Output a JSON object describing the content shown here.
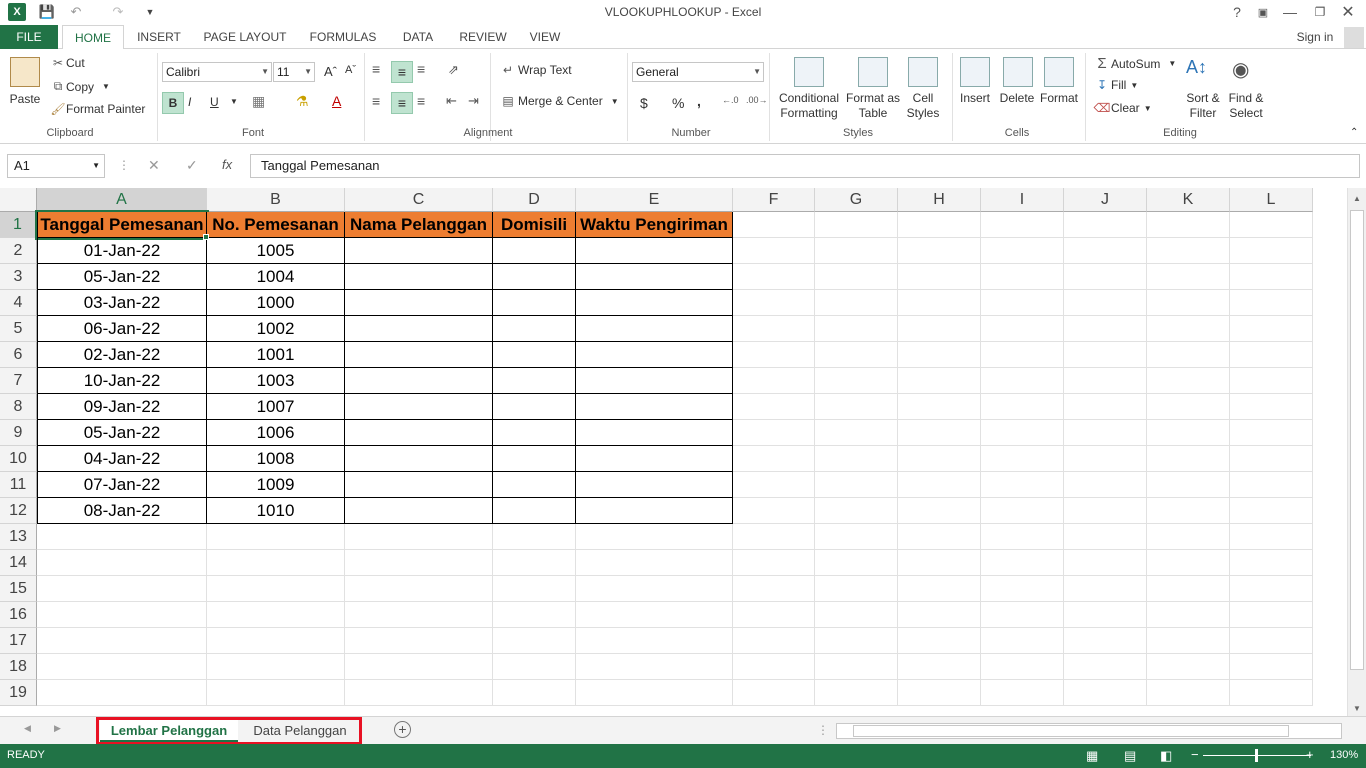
{
  "window": {
    "title": "VLOOKUPHLOOKUP - Excel",
    "help": "?",
    "signin": "Sign in"
  },
  "tabs": [
    "FILE",
    "HOME",
    "INSERT",
    "PAGE LAYOUT",
    "FORMULAS",
    "DATA",
    "REVIEW",
    "VIEW"
  ],
  "ribbon": {
    "clipboard": {
      "paste": "Paste",
      "cut": "Cut",
      "copy": "Copy",
      "format_painter": "Format Painter",
      "label": "Clipboard"
    },
    "font": {
      "name": "Calibri",
      "size": "11",
      "bold": "B",
      "italic": "I",
      "underline": "U",
      "label": "Font"
    },
    "alignment": {
      "wrap": "Wrap Text",
      "merge": "Merge & Center",
      "label": "Alignment"
    },
    "number": {
      "format": "General",
      "currency": "$",
      "percent": "%",
      "comma": ",",
      "label": "Number"
    },
    "styles": {
      "conditional": "Conditional",
      "conditional2": "Formatting",
      "format_as": "Format as",
      "format_as2": "Table",
      "cell": "Cell",
      "cell2": "Styles",
      "label": "Styles"
    },
    "cells": {
      "insert": "Insert",
      "delete": "Delete",
      "format": "Format",
      "label": "Cells"
    },
    "editing": {
      "autosum": "AutoSum",
      "fill": "Fill",
      "clear": "Clear",
      "sort": "Sort &",
      "sort2": "Filter",
      "find": "Find &",
      "find2": "Select",
      "label": "Editing"
    }
  },
  "formula_bar": {
    "namebox": "A1",
    "fx": "fx",
    "content": "Tanggal Pemesanan"
  },
  "columns": [
    "A",
    "B",
    "C",
    "D",
    "E",
    "F",
    "G",
    "H",
    "I",
    "J",
    "K",
    "L"
  ],
  "rows": [
    "1",
    "2",
    "3",
    "4",
    "5",
    "6",
    "7",
    "8",
    "9",
    "10",
    "11",
    "12",
    "13",
    "14",
    "15",
    "16",
    "17",
    "18",
    "19"
  ],
  "table": {
    "headers": [
      "Tanggal Pemesanan",
      "No. Pemesanan",
      "Nama Pelanggan",
      "Domisili",
      "Waktu Pengiriman"
    ],
    "rows": [
      [
        "01-Jan-22",
        "1005"
      ],
      [
        "05-Jan-22",
        "1004"
      ],
      [
        "03-Jan-22",
        "1000"
      ],
      [
        "06-Jan-22",
        "1002"
      ],
      [
        "02-Jan-22",
        "1001"
      ],
      [
        "10-Jan-22",
        "1003"
      ],
      [
        "09-Jan-22",
        "1007"
      ],
      [
        "05-Jan-22",
        "1006"
      ],
      [
        "04-Jan-22",
        "1008"
      ],
      [
        "07-Jan-22",
        "1009"
      ],
      [
        "08-Jan-22",
        "1010"
      ]
    ]
  },
  "sheets": [
    "Lembar Pelanggan",
    "Data Pelanggan"
  ],
  "status": {
    "ready": "READY",
    "zoom": "130%"
  },
  "colors": {
    "excel_green": "#217346",
    "header_fill": "#ed7d31",
    "highlight": "#e81123"
  }
}
